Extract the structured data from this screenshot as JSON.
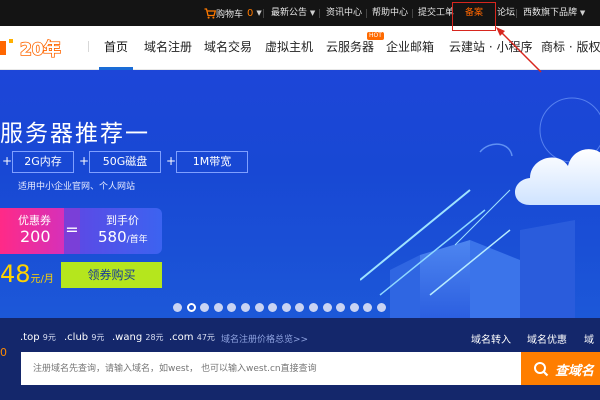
{
  "topbar": {
    "cart_label": "购物车",
    "cart_count": "0",
    "links": [
      "最新公告",
      "资讯中心",
      "帮助中心",
      "提交工单",
      "备案",
      "论坛",
      "西数旗下品牌"
    ],
    "highlighted": "备案"
  },
  "logo": {
    "text": "20年",
    "accent": "#ff6600"
  },
  "nav": {
    "items": [
      "首页",
      "域名注册",
      "域名交易",
      "虚拟主机",
      "云服务器",
      "企业邮箱",
      "云建站 · 小程序",
      "商标 · 版权"
    ],
    "hot_badge": "HOT",
    "active": "首页",
    "accent": "#1a6cd6"
  },
  "hero": {
    "title": "服务器推荐一",
    "specs": [
      "2G内存",
      "50G磁盘",
      "1M带宽"
    ],
    "subtitle": "适用中小企业官网、个人网站",
    "coupon_label": "优惠券",
    "coupon_value": "200",
    "final_label": "到手价",
    "final_value": "580",
    "final_unit": "/首年",
    "price_value": "48",
    "price_unit": "元/月",
    "buy_button": "领券购买",
    "slide_count": 16,
    "active_slide": 2
  },
  "domain": {
    "tlds": [
      {
        "name": ".top",
        "price": "9元"
      },
      {
        "name": ".club",
        "price": "9元"
      },
      {
        "name": ".wang",
        "price": "28元"
      },
      {
        "name": ".com",
        "price": "47元"
      }
    ],
    "price_link": "域名注册价格总览>>",
    "right_links": [
      "域名转入",
      "域名优惠",
      "域"
    ],
    "left_mark": "0",
    "search_placeholder": "注册域名先查询，请输入域名，如west， 也可以输入west.cn直接查询",
    "search_button": "查域名"
  },
  "colors": {
    "topbar_bg": "#141414",
    "hero_bg": "#1d46d8",
    "strip_bg": "#14276b",
    "search_button": "#ff7e00",
    "annotation": "#d7261e"
  }
}
